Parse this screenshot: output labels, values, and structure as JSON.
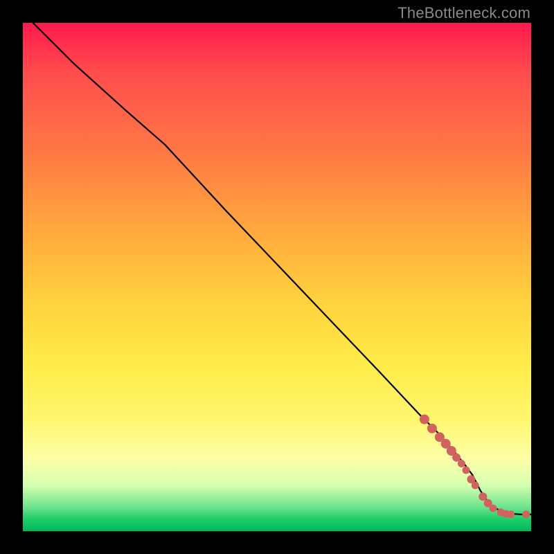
{
  "watermark": "TheBottleneck.com",
  "colors": {
    "frame": "#000000",
    "line": "#000000",
    "marker": "#d1635f",
    "gradient_stops": [
      "#ff1a4d",
      "#ff4d4d",
      "#ff7744",
      "#ffa63d",
      "#ffd23d",
      "#ffed4a",
      "#fff66e",
      "#fdffa8",
      "#d4ffb0",
      "#66e28a",
      "#21cf6b",
      "#00b85c"
    ]
  },
  "chart_data": {
    "type": "line",
    "title": "",
    "xlabel": "",
    "ylabel": "",
    "xlim": [
      0,
      100
    ],
    "ylim": [
      0,
      100
    ],
    "grid": false,
    "legend": false,
    "series": [
      {
        "name": "bottleneck-curve",
        "x": [
          2,
          10,
          20,
          28,
          40,
          50,
          60,
          70,
          78,
          82,
          85,
          87,
          88.5,
          90,
          92,
          95,
          98,
          100
        ],
        "y": [
          100,
          92,
          83,
          76,
          63,
          52.5,
          42,
          31.5,
          23,
          19,
          15.5,
          13,
          11,
          8,
          5,
          3.5,
          3.3,
          3.3
        ]
      }
    ],
    "points": [
      {
        "name": "cluster-upper-start",
        "x": 79,
        "y": 22,
        "r": 7
      },
      {
        "name": "cluster-upper-a",
        "x": 80.5,
        "y": 20.2,
        "r": 7
      },
      {
        "name": "cluster-upper-b",
        "x": 82,
        "y": 18.5,
        "r": 7
      },
      {
        "name": "cluster-upper-c",
        "x": 83.2,
        "y": 17.2,
        "r": 7
      },
      {
        "name": "cluster-upper-d",
        "x": 84.3,
        "y": 15.8,
        "r": 7
      },
      {
        "name": "cluster-upper-e",
        "x": 85.3,
        "y": 14.5,
        "r": 6
      },
      {
        "name": "cluster-mid-a",
        "x": 86.3,
        "y": 13.3,
        "r": 5.5
      },
      {
        "name": "cluster-mid-b",
        "x": 87.2,
        "y": 12.0,
        "r": 5.5
      },
      {
        "name": "cluster-mid-c",
        "x": 88.2,
        "y": 10.2,
        "r": 6
      },
      {
        "name": "cluster-mid-d",
        "x": 89.0,
        "y": 9.0,
        "r": 5.5
      },
      {
        "name": "cluster-low-a",
        "x": 90.5,
        "y": 6.8,
        "r": 6
      },
      {
        "name": "cluster-low-b",
        "x": 91.5,
        "y": 5.5,
        "r": 6
      },
      {
        "name": "cluster-low-c",
        "x": 92.5,
        "y": 4.5,
        "r": 5.5
      },
      {
        "name": "flat-a",
        "x": 94.0,
        "y": 3.7,
        "r": 5.5
      },
      {
        "name": "flat-b",
        "x": 95.0,
        "y": 3.4,
        "r": 5.5
      },
      {
        "name": "flat-c",
        "x": 96.0,
        "y": 3.3,
        "r": 5.5
      },
      {
        "name": "flat-gap",
        "x": 99.0,
        "y": 3.3,
        "r": 5.5
      }
    ]
  }
}
